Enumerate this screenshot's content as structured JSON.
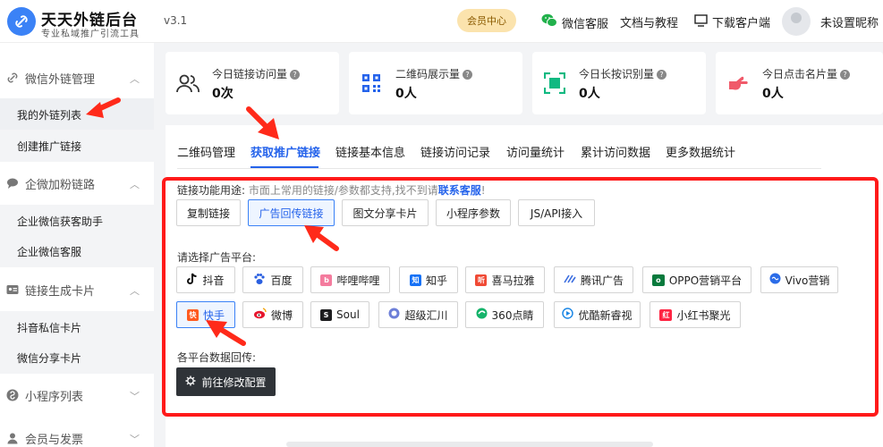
{
  "header": {
    "brand_title": "天天外链后台",
    "brand_subtitle": "专业私域推广引流工具",
    "version": "v3.1",
    "vip_label": "会员中心",
    "wechat_service": "微信客服",
    "docs": "文档与教程",
    "download": "下载客户端",
    "username": "未设置昵称"
  },
  "sidebar": {
    "sections": [
      {
        "label": "微信外链管理",
        "items": [
          "我的外链列表",
          "创建推广链接"
        ]
      },
      {
        "label": "企微加粉链路",
        "items": [
          "企业微信获客助手",
          "企业微信客服"
        ]
      },
      {
        "label": "链接生成卡片",
        "items": [
          "抖音私信卡片",
          "微信分享卡片"
        ]
      },
      {
        "label": "小程序列表",
        "items": []
      },
      {
        "label": "会员与发票",
        "items": []
      }
    ]
  },
  "stats": [
    {
      "label": "今日链接访问量",
      "value": "0次"
    },
    {
      "label": "二维码展示量",
      "value": "0人"
    },
    {
      "label": "今日长按识别量",
      "value": "0人"
    },
    {
      "label": "今日点击名片量",
      "value": "0人"
    }
  ],
  "tabs": [
    "二维码管理",
    "获取推广链接",
    "链接基本信息",
    "链接访问记录",
    "访问量统计",
    "累计访问数据",
    "更多数据统计"
  ],
  "usage": {
    "label": "链接功能用途:",
    "hint": "市面上常用的链接/参数都支持,找不到请",
    "link": "联系客服",
    "end": "!",
    "buttons": [
      "复制链接",
      "广告回传链接",
      "图文分享卡片",
      "小程序参数",
      "JS/API接入"
    ]
  },
  "platform": {
    "label": "请选择广告平台:",
    "row1": [
      "抖音",
      "百度",
      "哔哩哔哩",
      "知乎",
      "喜马拉雅",
      "腾讯广告",
      "OPPO营销平台",
      "Vivo营销"
    ],
    "row2": [
      "快手",
      "微博",
      "Soul",
      "超级汇川",
      "360点睛",
      "优酷新睿视",
      "小红书聚光"
    ]
  },
  "callback": {
    "label": "各平台数据回传:",
    "button": "前往修改配置"
  },
  "colors": {
    "accent": "#2563eb",
    "highlight_frame": "#ff1a1a",
    "dark_button": "#2f3338"
  }
}
